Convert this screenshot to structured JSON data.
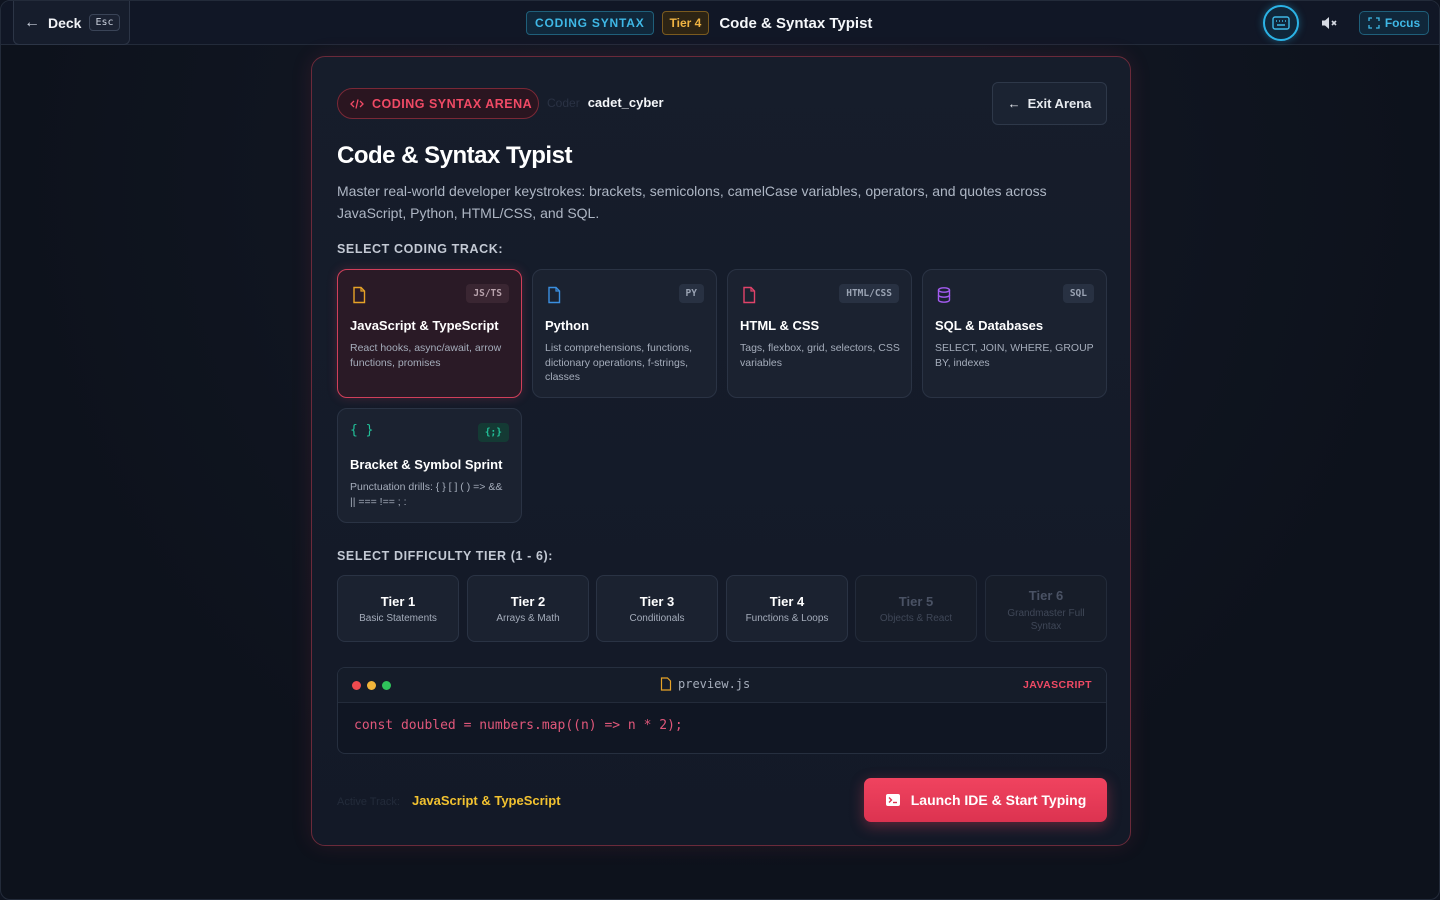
{
  "topbar": {
    "back_label": "Deck",
    "back_key": "Esc",
    "category": "CODING SYNTAX",
    "tier": "Tier 4",
    "title": "Code & Syntax Typist",
    "focus_label": "Focus"
  },
  "card": {
    "badge": "CODING SYNTAX ARENA",
    "coder_label": "Coder",
    "coder_name": "cadet_cyber",
    "exit_label": "Exit Arena",
    "title": "Code & Syntax Typist",
    "description": "Master real-world developer keystrokes: brackets, semicolons, camelCase variables, operators, and quotes across JavaScript, Python, HTML/CSS, and SQL."
  },
  "tracks_label": "SELECT CODING TRACK:",
  "tracks": [
    {
      "name": "JavaScript & TypeScript",
      "tag": "JS/TS",
      "desc": "React hooks, async/await, arrow functions, promises",
      "color": "#e6a227",
      "selected": true
    },
    {
      "name": "Python",
      "tag": "PY",
      "desc": "List comprehensions, functions, dictionary operations, f-strings, classes",
      "color": "#3b8fe0",
      "selected": false
    },
    {
      "name": "HTML & CSS",
      "tag": "HTML/CSS",
      "desc": "Tags, flexbox, grid, selectors, CSS variables",
      "color": "#e0436a",
      "selected": false
    },
    {
      "name": "SQL & Databases",
      "tag": "SQL",
      "desc": "SELECT, JOIN, WHERE, GROUP BY, indexes",
      "color": "#a35bf0",
      "selected": false
    },
    {
      "name": "Bracket & Symbol Sprint",
      "tag": "{;}",
      "desc": "Punctuation drills: { } [ ] ( ) => && || === !== ; :",
      "color": "#22c29a",
      "selected": false
    }
  ],
  "tiers_label": "SELECT DIFFICULTY TIER (1 - 6):",
  "tiers": [
    {
      "name": "Tier 1",
      "sub": "Basic Statements"
    },
    {
      "name": "Tier 2",
      "sub": "Arrays & Math"
    },
    {
      "name": "Tier 3",
      "sub": "Conditionals"
    },
    {
      "name": "Tier 4",
      "sub": "Functions & Loops"
    },
    {
      "name": "Tier 5",
      "sub": "Objects & React"
    },
    {
      "name": "Tier 6",
      "sub": "Grandmaster Full Syntax"
    }
  ],
  "editor": {
    "filename": "preview.js",
    "language": "JAVASCRIPT",
    "code": "const doubled = numbers.map((n) => n * 2);"
  },
  "footer": {
    "active_label": "Active Track:",
    "active_value": "JavaScript & TypeScript",
    "launch_label": "Launch IDE & Start Typing"
  }
}
